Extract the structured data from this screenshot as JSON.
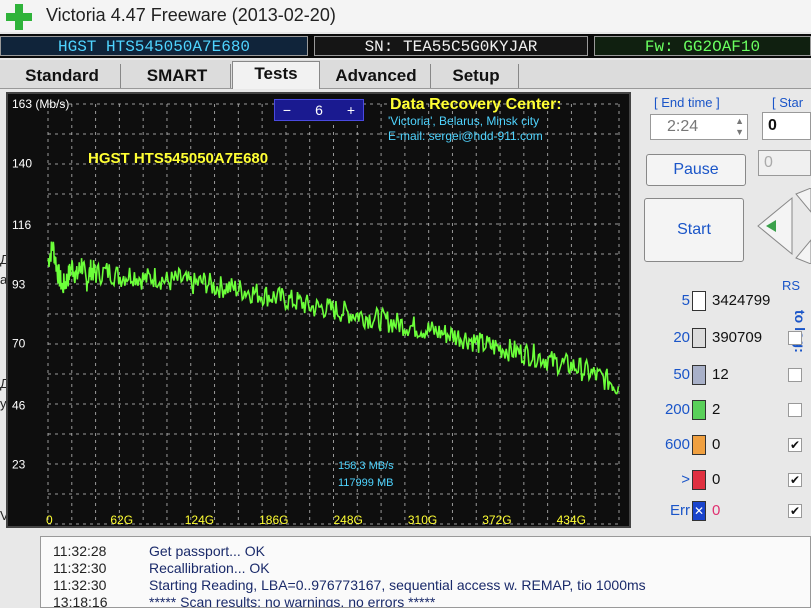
{
  "window": {
    "title": "Victoria 4.47  Freeware (2013-02-20)"
  },
  "drive": {
    "model": "HGST HTS545050A7E680",
    "sn": "SN: TEA55C5G0KYJAR",
    "fw": "Fw: GG2OAF10"
  },
  "tabs": [
    {
      "label": "Standard",
      "active": false
    },
    {
      "label": "SMART",
      "active": false
    },
    {
      "label": "Tests",
      "active": true
    },
    {
      "label": "Advanced",
      "active": false
    },
    {
      "label": "Setup",
      "active": false
    }
  ],
  "graph": {
    "unit_label": "163 (Mb/s)",
    "drive_label": "HGST HTS545050A7E680",
    "stepper": {
      "minus": "−",
      "value": "6",
      "plus": "+"
    },
    "info": {
      "line1": "Data Recovery Center:",
      "line2": "'Victoria', Belarus, Minsk city",
      "line3": "E-mail: sergei@hdd-911.com"
    },
    "speed": "158,3 MB/s",
    "position": "117999 MB",
    "colors": {
      "background": "#0e0e0e",
      "grid": "#c8c8c8",
      "trace": "#6cff3a",
      "text": "#ffff33",
      "info": "#4fd4ff"
    }
  },
  "chart_data": {
    "type": "line",
    "title": "",
    "xlabel": "",
    "ylabel": "163 (Mb/s)",
    "xlim": [
      0,
      476
    ],
    "ylim": [
      0,
      163
    ],
    "x_ticks": [
      "0",
      "62G",
      "124G",
      "186G",
      "248G",
      "310G",
      "372G",
      "434G"
    ],
    "y_ticks": [
      "140",
      "116",
      "93",
      "70",
      "46",
      "23"
    ],
    "grid": true,
    "series": [
      {
        "color": "#6cff3a",
        "x": [
          0,
          4,
          8,
          12,
          16,
          20,
          24,
          28,
          32,
          36,
          40,
          50,
          60,
          70,
          80,
          90,
          100,
          110,
          120,
          130,
          140,
          150,
          160,
          170,
          180,
          190,
          200,
          210,
          220,
          230,
          240,
          250,
          260,
          270,
          280,
          290,
          300,
          310,
          320,
          330,
          340,
          350,
          360,
          370,
          380,
          390,
          400,
          410,
          420,
          430,
          440,
          450,
          460,
          470,
          476
        ],
        "y": [
          102,
          108,
          98,
          92,
          95,
          100,
          96,
          101,
          94,
          99,
          97,
          98,
          96,
          97,
          95,
          96,
          94,
          95,
          93,
          94,
          92,
          92,
          91,
          90,
          89,
          88,
          87,
          86,
          84,
          84,
          83,
          82,
          81,
          80,
          79,
          78,
          77,
          76,
          75,
          74,
          73,
          72,
          70,
          69,
          68,
          67,
          66,
          65,
          63,
          62,
          61,
          59,
          57,
          55,
          53
        ]
      }
    ]
  },
  "right_panel": {
    "end_time_label": "[ End time ]",
    "start_label": "[ Star",
    "end_time_value": "2:24",
    "start_value": "0",
    "second_value": "0",
    "pause_label": "Pause",
    "start_button": "Start",
    "rs_label": "RS",
    "to_log_label": "to log:",
    "legend": [
      {
        "limit": "5",
        "count": "3424799",
        "color": "#ffffff",
        "checked": false
      },
      {
        "limit": "20",
        "count": "390709",
        "color": "#dcdcdc",
        "checked": false
      },
      {
        "limit": "50",
        "count": "12",
        "color": "#a8b0c8",
        "checked": false
      },
      {
        "limit": "200",
        "count": "2",
        "color": "#5ad05a",
        "checked": false
      },
      {
        "limit": "600",
        "count": "0",
        "color": "#f0a040",
        "checked": true
      },
      {
        "limit": ">",
        "count": "0",
        "color": "#e03040",
        "checked": true
      },
      {
        "limit": "Err",
        "count": "0",
        "color": "#1a44cc",
        "checked": true
      }
    ],
    "check_mark": "✔",
    "err_mark": "✕"
  },
  "log": [
    {
      "time": "11:32:28",
      "text": "Get passport... OK"
    },
    {
      "time": "11:32:30",
      "text": "Recallibration... OK"
    },
    {
      "time": "11:32:30",
      "text": "Starting Reading, LBA=0..976773167, sequential access w. REMAP, tio 1000ms"
    },
    {
      "time": "13:18:16",
      "text": "***** Scan results: no warnings, no errors *****"
    }
  ],
  "left_edge_glyphs": [
    "Д",
    "а",
    "Д",
    "у",
    "V"
  ]
}
